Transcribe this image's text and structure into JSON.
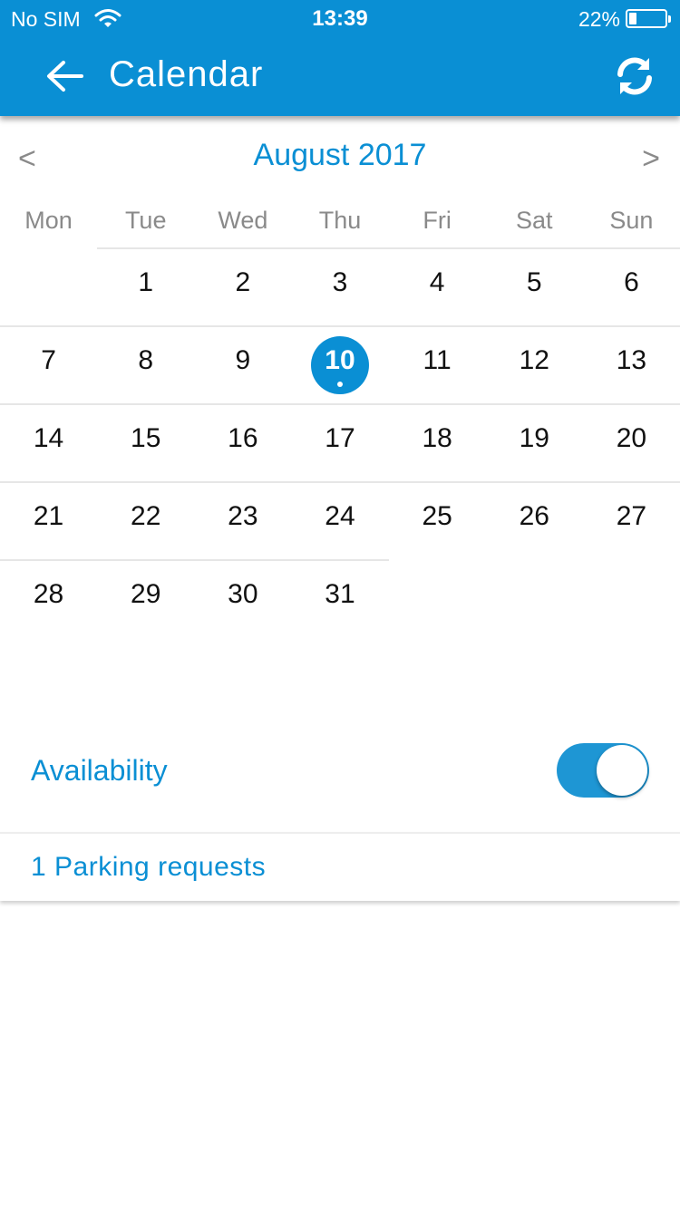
{
  "status_bar": {
    "carrier": "No SIM",
    "time": "13:39",
    "battery_percent_label": "22%",
    "battery_level": 0.22
  },
  "header": {
    "title": "Calendar",
    "back_icon": "arrow-left-icon",
    "refresh_icon": "refresh-icon",
    "background_color": "#0a8fd4"
  },
  "calendar": {
    "month_title": "August 2017",
    "prev_label": "<",
    "next_label": ">",
    "weekdays": [
      "Mon",
      "Tue",
      "Wed",
      "Thu",
      "Fri",
      "Sat",
      "Sun"
    ],
    "weeks": [
      [
        "",
        "1",
        "2",
        "3",
        "4",
        "5",
        "6"
      ],
      [
        "7",
        "8",
        "9",
        "10",
        "11",
        "12",
        "13"
      ],
      [
        "14",
        "15",
        "16",
        "17",
        "18",
        "19",
        "20"
      ],
      [
        "21",
        "22",
        "23",
        "24",
        "25",
        "26",
        "27"
      ],
      [
        "28",
        "29",
        "30",
        "31",
        "",
        "",
        ""
      ]
    ],
    "selected_day": "10",
    "accent_color": "#0a8fd4"
  },
  "availability": {
    "label": "Availability",
    "enabled": true
  },
  "parking": {
    "label": "1 Parking requests"
  }
}
